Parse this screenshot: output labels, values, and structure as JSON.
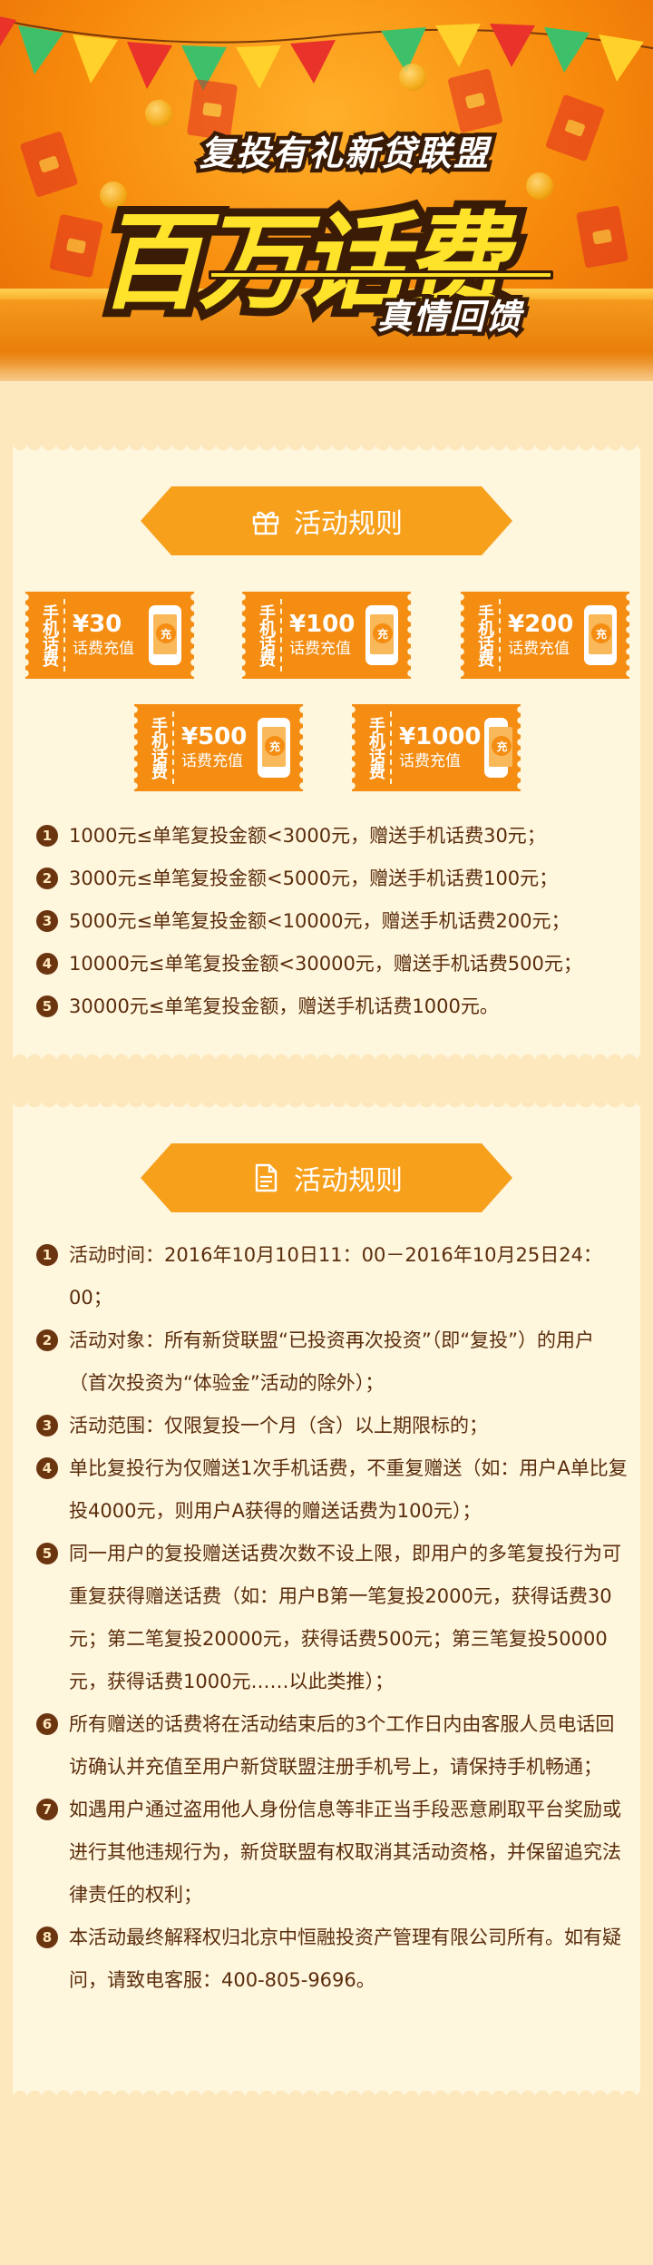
{
  "hero": {
    "subtitle": "复投有礼新贷联盟",
    "main_title": "百万话费",
    "tagline": "真情回馈"
  },
  "colors": {
    "accent": "#f7a01c",
    "voucher": "#f48d12",
    "text": "#5a2d0c",
    "background": "#fde8be",
    "panel": "#fff6de"
  },
  "section1": {
    "title": "活动规则",
    "icon": "gift-icon",
    "vouchers": [
      {
        "side": "手机话费",
        "amount": "¥30",
        "desc": "话费充值",
        "badge": "充"
      },
      {
        "side": "手机话费",
        "amount": "¥100",
        "desc": "话费充值",
        "badge": "充"
      },
      {
        "side": "手机话费",
        "amount": "¥200",
        "desc": "话费充值",
        "badge": "充"
      },
      {
        "side": "手机话费",
        "amount": "¥500",
        "desc": "话费充值",
        "badge": "充"
      },
      {
        "side": "手机话费",
        "amount": "¥1000",
        "desc": "话费充值",
        "badge": "充"
      }
    ],
    "rules": [
      {
        "num": "1",
        "text": "1000元≤单笔复投金额<3000元，赠送手机话费30元；"
      },
      {
        "num": "2",
        "text": "3000元≤单笔复投金额<5000元，赠送手机话费100元；"
      },
      {
        "num": "3",
        "text": "5000元≤单笔复投金额<10000元，赠送手机话费200元；"
      },
      {
        "num": "4",
        "text": "10000元≤单笔复投金额<30000元，赠送手机话费500元；"
      },
      {
        "num": "5",
        "text": "30000元≤单笔复投金额，赠送手机话费1000元。"
      }
    ]
  },
  "section2": {
    "title": "活动规则",
    "icon": "document-icon",
    "rules": [
      {
        "num": "1",
        "text": "活动时间：2016年10月10日11：00－2016年10月25日24：00；"
      },
      {
        "num": "2",
        "text": "活动对象：所有新贷联盟“已投资再次投资”（即“复投”）的用户（首次投资为“体验金”活动的除外）；"
      },
      {
        "num": "3",
        "text": "活动范围：仅限复投一个月（含）以上期限标的；"
      },
      {
        "num": "4",
        "text": "单比复投行为仅赠送1次手机话费，不重复赠送（如：用户A单比复投4000元，则用户A获得的赠送话费为100元）；"
      },
      {
        "num": "5",
        "text": "同一用户的复投赠送话费次数不设上限，即用户的多笔复投行为可重复获得赠送话费（如：用户B第一笔复投2000元，获得话费30元；第二笔复投20000元，获得话费500元；第三笔复投50000元，获得话费1000元……以此类推）；"
      },
      {
        "num": "6",
        "text": "所有赠送的话费将在活动结束后的3个工作日内由客服人员电话回访确认并充值至用户新贷联盟注册手机号上，请保持手机畅通；"
      },
      {
        "num": "7",
        "text": "如遇用户通过盗用他人身份信息等非正当手段恶意刷取平台奖励或进行其他违规行为，新贷联盟有权取消其活动资格，并保留追究法律责任的权利；"
      },
      {
        "num": "8",
        "text": "本活动最终解释权归北京中恒融投资产管理有限公司所有。如有疑问，请致电客服：400-805-9696。"
      }
    ]
  }
}
